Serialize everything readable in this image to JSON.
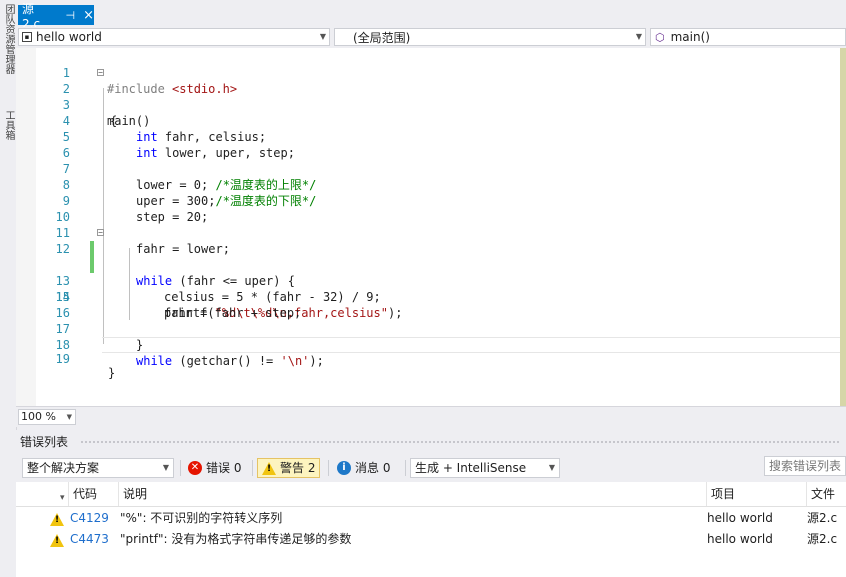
{
  "sidebar": {
    "labels": [
      "团队资源管理器",
      "工具箱"
    ]
  },
  "tab": {
    "title": "源2.c",
    "pin_glyph": "⊣",
    "close_glyph": "×"
  },
  "navbar": {
    "project": "hello world",
    "scope": "(全局范围)",
    "member": "main()"
  },
  "editor": {
    "lines": [
      {
        "num": "1"
      },
      {
        "num": "2"
      },
      {
        "num": "3"
      },
      {
        "num": "4"
      },
      {
        "num": "5"
      },
      {
        "num": "6"
      },
      {
        "num": "7"
      },
      {
        "num": "8"
      },
      {
        "num": "9"
      },
      {
        "num": "10"
      },
      {
        "num": "11"
      },
      {
        "num": "12"
      },
      {
        "num": "13"
      },
      {
        "num": "14"
      },
      {
        "num": "15"
      },
      {
        "num": "16"
      },
      {
        "num": "17"
      },
      {
        "num": "18"
      },
      {
        "num": "19"
      }
    ],
    "code": {
      "l1_a": "#include ",
      "l1_b": "<stdio.h>",
      "l2": "main()",
      "l3": "{",
      "l4_kw": "int",
      "l4_rest": " fahr, celsius;",
      "l5_kw": "int",
      "l5_rest": " lower, uper, step;",
      "l7_a": "lower = 0; ",
      "l7_c": "/*温度表的上限*/",
      "l8_a": "uper = 300;",
      "l8_c": "/*温度表的下限*/",
      "l9": "step = 20;",
      "l11": "fahr = lower;",
      "l12_kw": "while",
      "l12_rest": " (fahr <= uper) {",
      "l13": "celsius = 5 * (fahr - 32) / 9;",
      "l14_a": "printf(",
      "l14_s": "\"%d\\t\\%d\\n,fahr,celsius\"",
      "l14_b": ");",
      "l15": "fahr = fahr + step;",
      "l17": "}",
      "l18_kw": "while",
      "l18_a": " (getchar() != ",
      "l18_s": "'\\n'",
      "l18_b": ");",
      "l19": "}"
    },
    "zoom": "100 %"
  },
  "error_list": {
    "title": "错误列表",
    "scope_filter": "整个解决方案",
    "errors_label": "错误 0",
    "warnings_label": "警告 2",
    "messages_label": "消息 0",
    "build_filter": "生成 + IntelliSense",
    "search_placeholder": "搜索错误列表",
    "columns": {
      "code": "代码",
      "description": "说明",
      "project": "项目",
      "file": "文件"
    },
    "rows": [
      {
        "code": "C4129",
        "description": "\"%\": 不可识别的字符转义序列",
        "project": "hello world",
        "file": "源2.c"
      },
      {
        "code": "C4473",
        "description": "\"printf\": 没有为格式字符串传递足够的参数",
        "project": "hello world",
        "file": "源2.c"
      }
    ]
  },
  "colors": {
    "accent": "#007acc",
    "keyword": "#0000ff",
    "comment": "#008000",
    "string": "#a31515",
    "line_number": "#2b91af",
    "change_marker": "#6cca6c",
    "warning": "#f1c40f",
    "error": "#e51400",
    "info": "#1e78c8"
  }
}
